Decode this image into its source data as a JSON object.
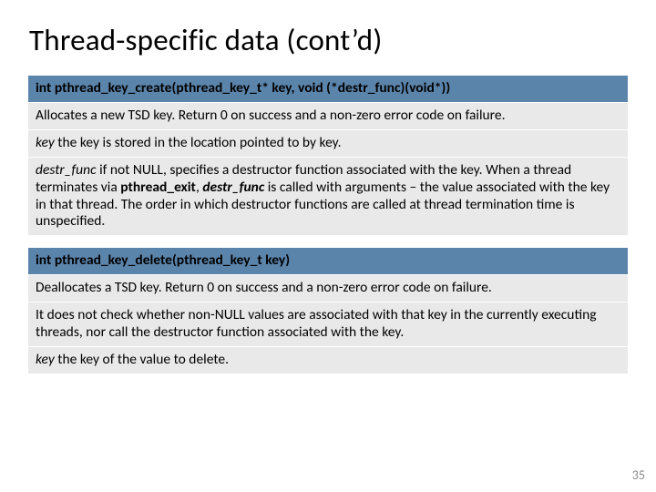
{
  "title": "Thread-specific data (cont’d)",
  "panel1": {
    "header": "int pthread_key_create(pthread_key_t* key, void (*destr_func)(void*))",
    "row1": "Allocates a new TSD key. Return 0 on success and a non-zero error code on failure.",
    "row2_lead": "key",
    "row2_rest": " the key is stored in the location pointed to by key.",
    "row3_lead": "destr_func",
    "row3_a": " if not NULL, specifies a destructor function associated with the key. When a thread terminates via ",
    "row3_b1": "pthread_exit",
    "row3_c": ", ",
    "row3_b2": "destr_func",
    "row3_d": " is called with arguments – the value associated with the key in that thread. The order in which destructor functions are called at thread termination time is unspecified."
  },
  "panel2": {
    "header": "int pthread_key_delete(pthread_key_t key)",
    "row1": "Deallocates a TSD key. Return 0 on success and a non-zero error code on failure.",
    "row2": "It does not check whether non-NULL values are associated with that key in the currently executing threads, nor call the destructor function associated with the key.",
    "row3_lead": "key",
    "row3_rest": " the key of the value to delete."
  },
  "pagenum": "35"
}
